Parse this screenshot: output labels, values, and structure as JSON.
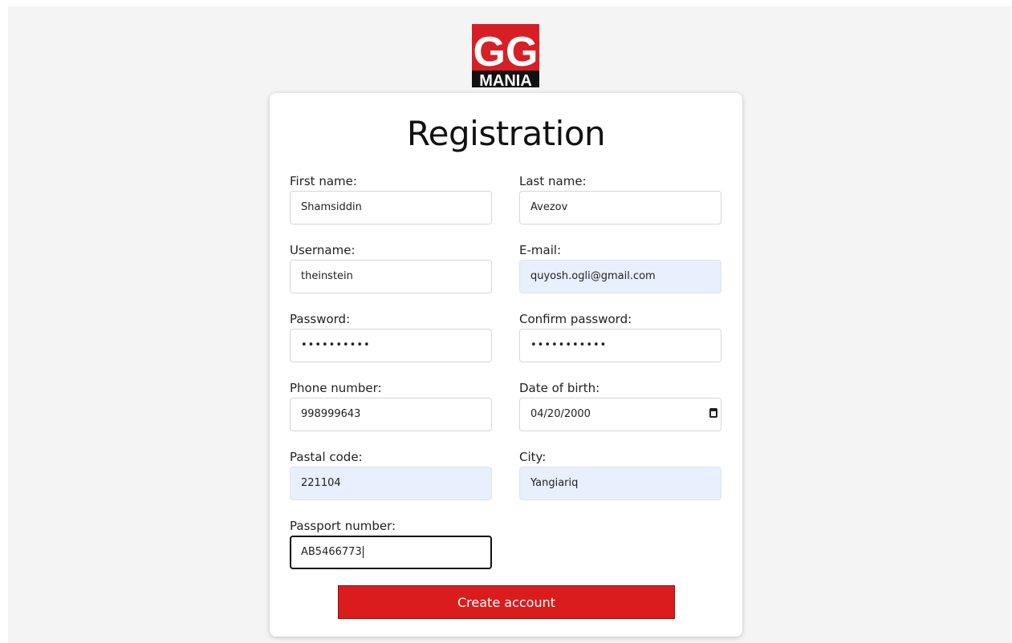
{
  "logo": {
    "top_text": "GG",
    "bottom_text": "MANIA"
  },
  "form": {
    "title": "Registration",
    "first_name": {
      "label": "First name:",
      "value": "Shamsiddin"
    },
    "last_name": {
      "label": "Last name:",
      "value": "Avezov"
    },
    "username": {
      "label": "Username:",
      "value": "theinstein"
    },
    "email": {
      "label": "E-mail:",
      "value": "quyosh.ogli@gmail.com"
    },
    "password": {
      "label": "Password:",
      "value": "••••••••••"
    },
    "confirm_password": {
      "label": "Confirm password:",
      "value": "•••••••••••"
    },
    "phone": {
      "label": "Phone number:",
      "value": "998999643"
    },
    "dob": {
      "label": "Date of birth:",
      "value": "04/20/2000"
    },
    "postal_code": {
      "label": "Pastal code:",
      "value": "221104"
    },
    "city": {
      "label": "City:",
      "value": "Yangiariq"
    },
    "passport": {
      "label": "Passport number:",
      "value": "AB5466773"
    },
    "submit_label": "Create account"
  },
  "colors": {
    "accent": "#db1c1c",
    "autofill": "#e8f0fe",
    "background": "#f4f4f4"
  },
  "icons": {
    "date_picker": "calendar-icon"
  }
}
